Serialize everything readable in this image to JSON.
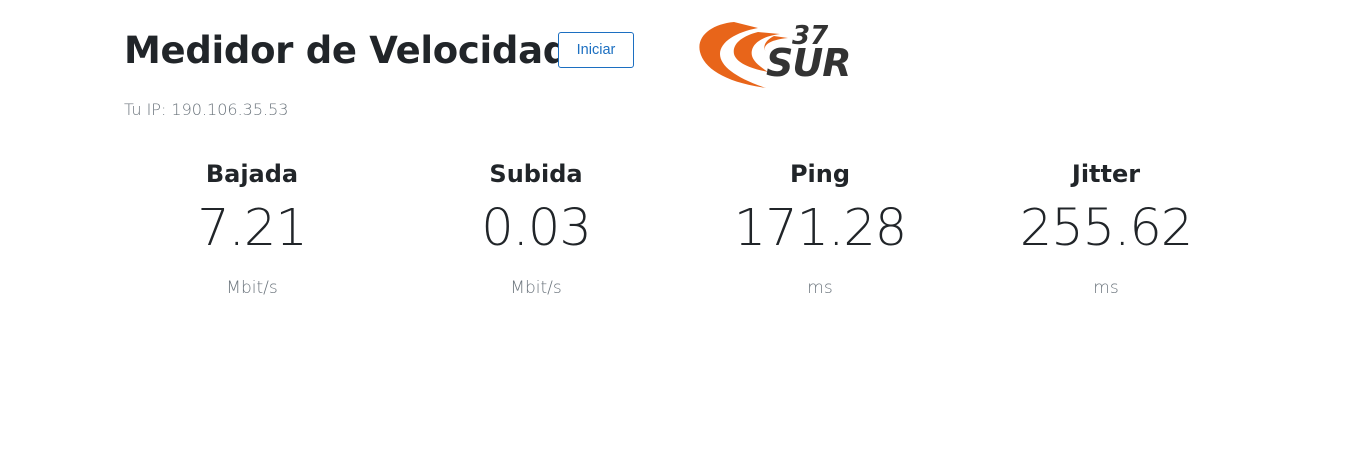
{
  "header": {
    "title": "Medidor de Velocidad",
    "start_button_label": "Iniciar"
  },
  "logo": {
    "number_text": "37",
    "brand_text": "SUR",
    "accent_color": "#e8651a",
    "text_color": "#333333"
  },
  "ip": {
    "label": "Tu IP:",
    "value": "190.106.35.53"
  },
  "metrics": [
    {
      "label": "Bajada",
      "value": "7.21",
      "unit": "Mbit/s"
    },
    {
      "label": "Subida",
      "value": "0.03",
      "unit": "Mbit/s"
    },
    {
      "label": "Ping",
      "value": "171.28",
      "unit": "ms"
    },
    {
      "label": "Jitter",
      "value": "255.62",
      "unit": "ms"
    }
  ],
  "colors": {
    "button_accent": "#1c6fc1",
    "muted_text": "#6c757d",
    "main_text": "#212529"
  }
}
